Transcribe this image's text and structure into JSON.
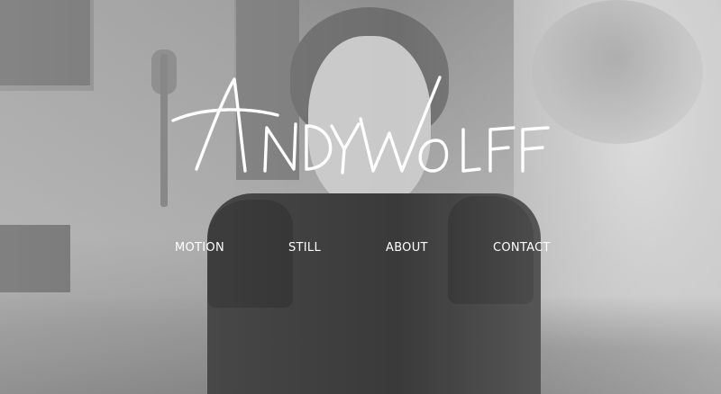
{
  "site": {
    "logo_text": "ANDY WOLFF",
    "text_color": "#ffffff"
  },
  "nav": {
    "items": [
      {
        "label": "MOTION"
      },
      {
        "label": "STILL"
      },
      {
        "label": "ABOUT"
      },
      {
        "label": "CONTACT"
      }
    ]
  },
  "hero": {
    "image": "black-and-white-portrait-woman-singing"
  }
}
